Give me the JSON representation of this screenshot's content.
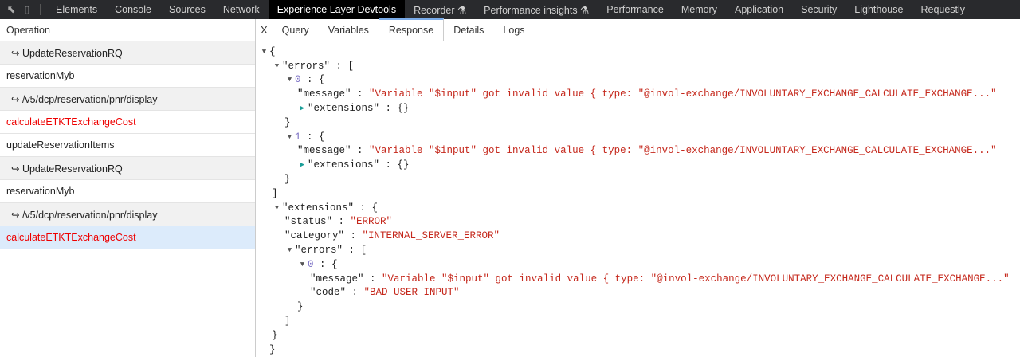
{
  "topbar": {
    "icons": [
      "inspect-icon",
      "device-toolbar-icon"
    ],
    "tabs": [
      "Elements",
      "Console",
      "Sources",
      "Network",
      "Experience Layer Devtools",
      "Recorder ⚗",
      "Performance insights ⚗",
      "Performance",
      "Memory",
      "Application",
      "Security",
      "Lighthouse",
      "Requestly"
    ],
    "active": 4
  },
  "left": {
    "header": "Operation",
    "rows": [
      {
        "label": "↪ UpdateReservationRQ",
        "type": "sub"
      },
      {
        "label": "reservationMyb",
        "type": "normal"
      },
      {
        "label": "↪ /v5/dcp/reservation/pnr/display",
        "type": "sub"
      },
      {
        "label": "calculateETKTExchangeCost",
        "type": "err"
      },
      {
        "label": "updateReservationItems",
        "type": "normal"
      },
      {
        "label": "↪ UpdateReservationRQ",
        "type": "sub"
      },
      {
        "label": "reservationMyb",
        "type": "normal"
      },
      {
        "label": "↪ /v5/dcp/reservation/pnr/display",
        "type": "sub"
      },
      {
        "label": "calculateETKTExchangeCost",
        "type": "err sel"
      }
    ]
  },
  "right": {
    "close": "X",
    "tabs": [
      "Query",
      "Variables",
      "Response",
      "Details",
      "Logs"
    ],
    "active": 2
  },
  "json": [
    {
      "i": 0,
      "t": "open",
      "p": "{"
    },
    {
      "i": 1,
      "t": "open",
      "k": "\"errors\"",
      "p": " : ["
    },
    {
      "i": 2,
      "t": "open",
      "x": "0",
      "p": " : {"
    },
    {
      "i": 3,
      "k": "\"message\"",
      "p": " : ",
      "v": "\"Variable \"$input\" got invalid value { type: \"@invol-exchange/INVOLUNTARY_EXCHANGE_CALCULATE_EXCHANGE...\""
    },
    {
      "i": 3,
      "t": "closed",
      "k": "\"extensions\"",
      "p": " : {}"
    },
    {
      "i": 2,
      "p": "}"
    },
    {
      "i": 2,
      "t": "open",
      "x": "1",
      "p": " : {"
    },
    {
      "i": 3,
      "k": "\"message\"",
      "p": " : ",
      "v": "\"Variable \"$input\" got invalid value { type: \"@invol-exchange/INVOLUNTARY_EXCHANGE_CALCULATE_EXCHANGE...\""
    },
    {
      "i": 3,
      "t": "closed",
      "k": "\"extensions\"",
      "p": " : {}"
    },
    {
      "i": 2,
      "p": "}"
    },
    {
      "i": 1,
      "p": "]"
    },
    {
      "i": 1,
      "t": "open",
      "k": "\"extensions\"",
      "p": " : {"
    },
    {
      "i": 2,
      "k": "\"status\"",
      "p": " : ",
      "v": "\"ERROR\""
    },
    {
      "i": 2,
      "k": "\"category\"",
      "p": " : ",
      "v": "\"INTERNAL_SERVER_ERROR\""
    },
    {
      "i": 2,
      "t": "open",
      "k": "\"errors\"",
      "p": " : ["
    },
    {
      "i": 3,
      "t": "open",
      "x": "0",
      "p": " : {"
    },
    {
      "i": 4,
      "k": "\"message\"",
      "p": " : ",
      "v": "\"Variable \"$input\" got invalid value { type: \"@invol-exchange/INVOLUNTARY_EXCHANGE_CALCULATE_EXCHANGE...\""
    },
    {
      "i": 4,
      "k": "\"code\"",
      "p": " : ",
      "v": "\"BAD_USER_INPUT\""
    },
    {
      "i": 3,
      "p": "}"
    },
    {
      "i": 2,
      "p": "]"
    },
    {
      "i": 1,
      "p": "}"
    },
    {
      "i": 0,
      "p": "}"
    }
  ]
}
